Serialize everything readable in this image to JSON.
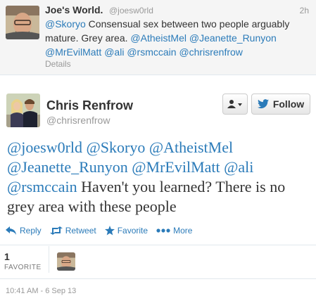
{
  "parent_tweet": {
    "author_name": "Joe's World.",
    "author_handle": "@joesw0rld",
    "time": "2h",
    "text_parts": [
      {
        "text": "@Skoryo",
        "link": true
      },
      {
        "text": " Consensual sex between two people arguably mature. Grey area. ",
        "link": false
      },
      {
        "text": "@AtheistMel",
        "link": true
      },
      {
        "text": " ",
        "link": false
      },
      {
        "text": "@Jeanette_Runyon",
        "link": true
      },
      {
        "text": " ",
        "link": false
      },
      {
        "text": "@MrEvilMatt",
        "link": true
      },
      {
        "text": " ",
        "link": false
      },
      {
        "text": "@ali",
        "link": true
      },
      {
        "text": " ",
        "link": false
      },
      {
        "text": "@rsmccain",
        "link": true
      },
      {
        "text": " ",
        "link": false
      },
      {
        "text": "@chrisrenfrow",
        "link": true
      }
    ],
    "details_label": "Details"
  },
  "main_tweet": {
    "author_name": "Chris Renfrow",
    "author_handle": "@chrisrenfrow",
    "follow_label": "Follow",
    "user_menu_icon": "user-dropdown-icon",
    "text_parts": [
      {
        "text": "@joesw0rld",
        "link": true
      },
      {
        "text": " ",
        "link": false
      },
      {
        "text": "@Skoryo",
        "link": true
      },
      {
        "text": " ",
        "link": false
      },
      {
        "text": "@AtheistMel",
        "link": true
      },
      {
        "text": " ",
        "link": false
      },
      {
        "text": "@Jeanette_Runyon",
        "link": true
      },
      {
        "text": " ",
        "link": false
      },
      {
        "text": "@MrEvilMatt",
        "link": true
      },
      {
        "text": " ",
        "link": false
      },
      {
        "text": "@ali",
        "link": true
      },
      {
        "text": " ",
        "link": false
      },
      {
        "text": "@rsmccain",
        "link": true
      },
      {
        "text": " Haven't you learned? There is no grey area with these people",
        "link": false
      }
    ],
    "actions": {
      "reply": "Reply",
      "retweet": "Retweet",
      "favorite": "Favorite",
      "more": "More"
    },
    "stats": {
      "favorite_count": "1",
      "favorite_label": "FAVORITE"
    },
    "timestamp": "10:41 AM - 6 Sep 13"
  },
  "colors": {
    "link": "#2b7bb9",
    "muted": "#999999",
    "text": "#333333",
    "parent_bg": "#f5f5f5"
  }
}
